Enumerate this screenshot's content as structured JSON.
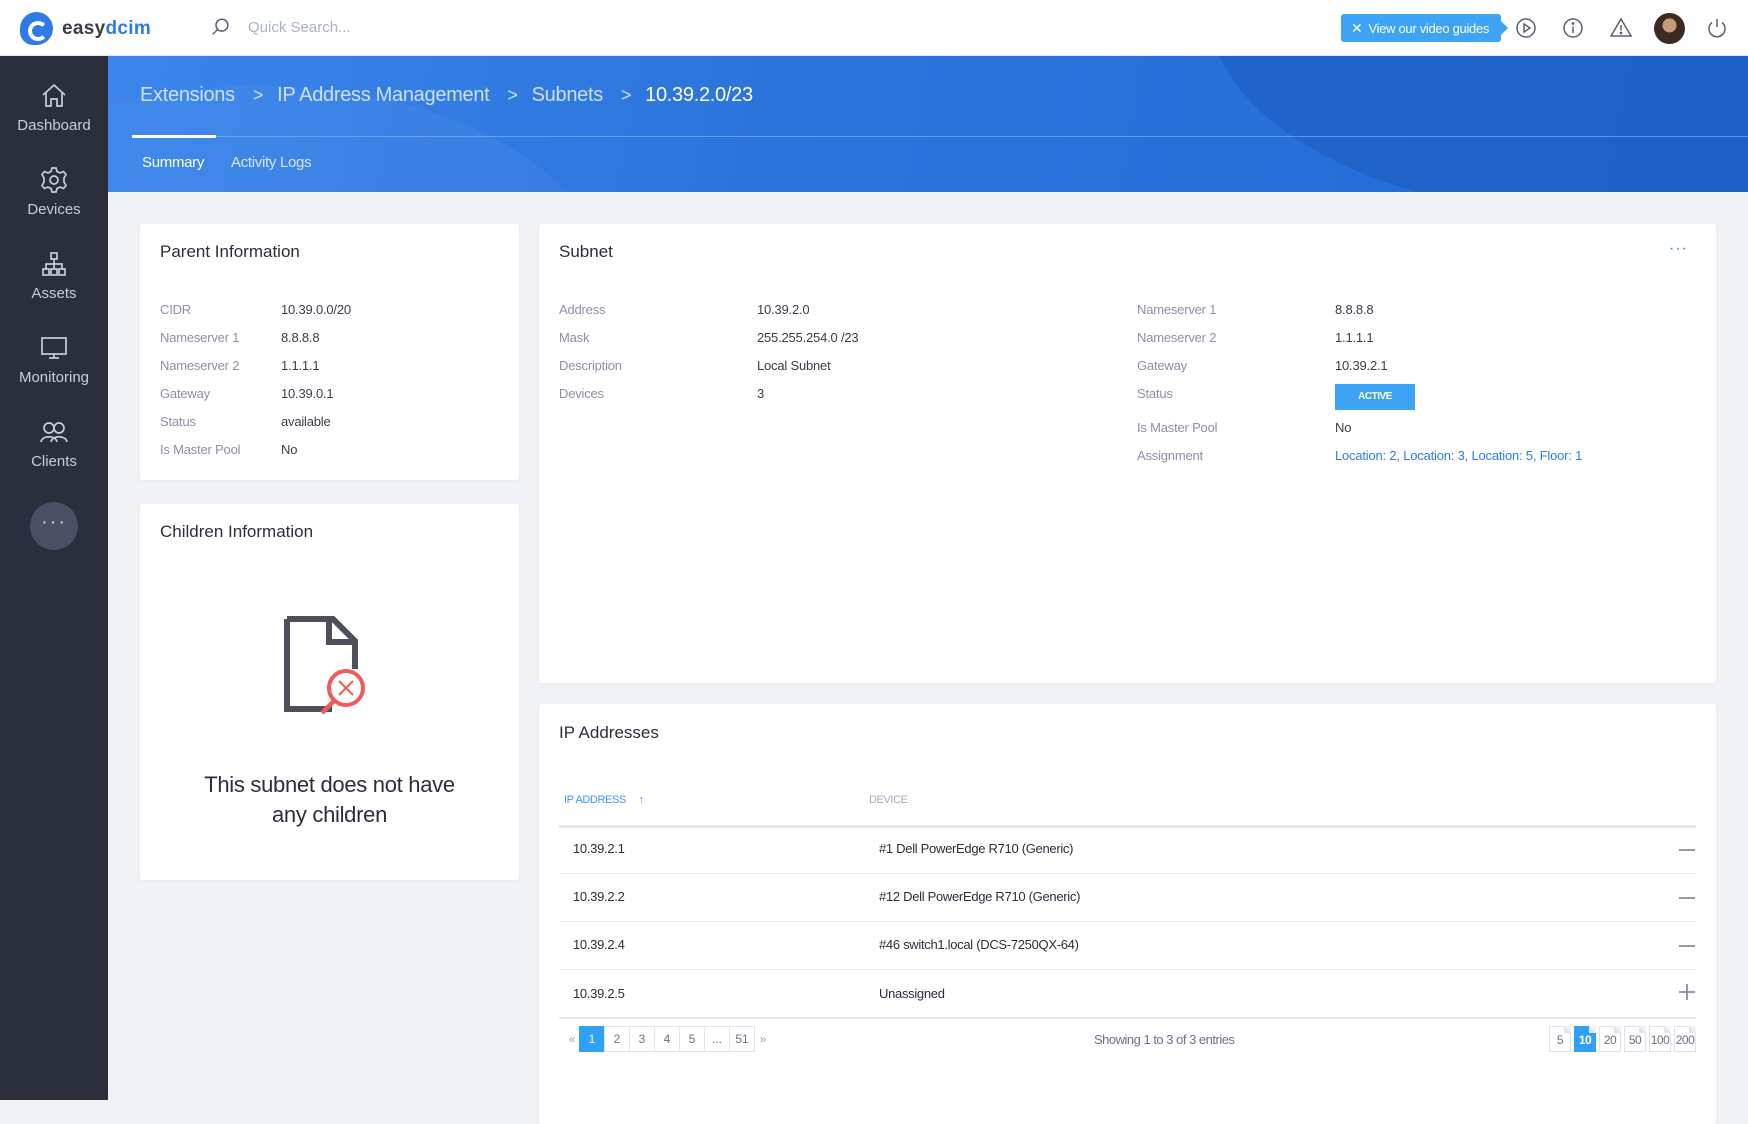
{
  "topbar": {
    "logo_part1": "easy",
    "logo_part2": "dcim",
    "search_placeholder": "Quick Search...",
    "video_guide_label": "View our video guides",
    "icons": [
      "play-circle-icon",
      "info-icon",
      "warning-icon",
      "avatar",
      "power-icon"
    ]
  },
  "sidebar": {
    "items": [
      {
        "label": "Dashboard",
        "icon": "home-icon"
      },
      {
        "label": "Devices",
        "icon": "gear-icon"
      },
      {
        "label": "Assets",
        "icon": "sitemap-icon"
      },
      {
        "label": "Monitoring",
        "icon": "monitor-icon"
      },
      {
        "label": "Clients",
        "icon": "users-icon"
      }
    ],
    "more_label": "···"
  },
  "breadcrumb": {
    "items": [
      "Extensions",
      "IP Address Management",
      "Subnets"
    ],
    "current": "10.39.2.0/23",
    "separator": ">"
  },
  "tabs": [
    {
      "label": "Summary",
      "active": true
    },
    {
      "label": "Activity Logs",
      "active": false
    }
  ],
  "parent_info": {
    "title": "Parent Information",
    "rows": [
      {
        "key": "CIDR",
        "value": "10.39.0.0/20"
      },
      {
        "key": "Nameserver 1",
        "value": "8.8.8.8"
      },
      {
        "key": "Nameserver 2",
        "value": "1.1.1.1"
      },
      {
        "key": "Gateway",
        "value": "10.39.0.1"
      },
      {
        "key": "Status",
        "value": "available"
      },
      {
        "key": "Is Master Pool",
        "value": "No"
      }
    ]
  },
  "children_info": {
    "title": "Children Information",
    "empty_line1": "This subnet does not have",
    "empty_line2": "any children"
  },
  "subnet": {
    "title": "Subnet",
    "menu_label": "···",
    "left_rows": [
      {
        "key": "Address",
        "value": "10.39.2.0"
      },
      {
        "key": "Mask",
        "value": "255.255.254.0 /23"
      },
      {
        "key": "Description",
        "value": "Local Subnet"
      },
      {
        "key": "Devices",
        "value": "3"
      }
    ],
    "right_rows": [
      {
        "key": "Nameserver 1",
        "value": "8.8.8.8"
      },
      {
        "key": "Nameserver 2",
        "value": "1.1.1.1"
      },
      {
        "key": "Gateway",
        "value": "10.39.2.1"
      },
      {
        "key": "Status",
        "value": "ACTIVE"
      },
      {
        "key": "Is Master Pool",
        "value": "No"
      },
      {
        "key": "Assignment",
        "value": "Location: 2, Location: 3, Location: 5, Floor: 1"
      }
    ],
    "status_color": "#3da3f5"
  },
  "ip_addresses": {
    "title": "IP Addresses",
    "columns": [
      "IP ADDRESS",
      "DEVICE"
    ],
    "sort_indicator": "↑",
    "rows": [
      {
        "ip": "10.39.2.1",
        "device": "#1 Dell PowerEdge R710 (Generic)",
        "action": "remove"
      },
      {
        "ip": "10.39.2.2",
        "device": "#12 Dell PowerEdge R710 (Generic)",
        "action": "remove"
      },
      {
        "ip": "10.39.2.4",
        "device": "#46 switch1.local (DCS-7250QX-64)",
        "action": "remove"
      },
      {
        "ip": "10.39.2.5",
        "device": "Unassigned",
        "action": "add"
      }
    ],
    "pagination": {
      "prev": "«",
      "next": "»",
      "pages": [
        "1",
        "2",
        "3",
        "4",
        "5",
        "...",
        "51"
      ],
      "current": "1"
    },
    "showing_text": "Showing 1 to 3 of 3 entries",
    "page_sizes": [
      "5",
      "10",
      "20",
      "50",
      "100",
      "200"
    ],
    "page_size_selected": "10"
  },
  "colors": {
    "accent": "#2e7be6",
    "sidebar_bg": "#2b2e3b",
    "badge": "#3da3f5",
    "empty_icon_red": "#f05a5a"
  }
}
